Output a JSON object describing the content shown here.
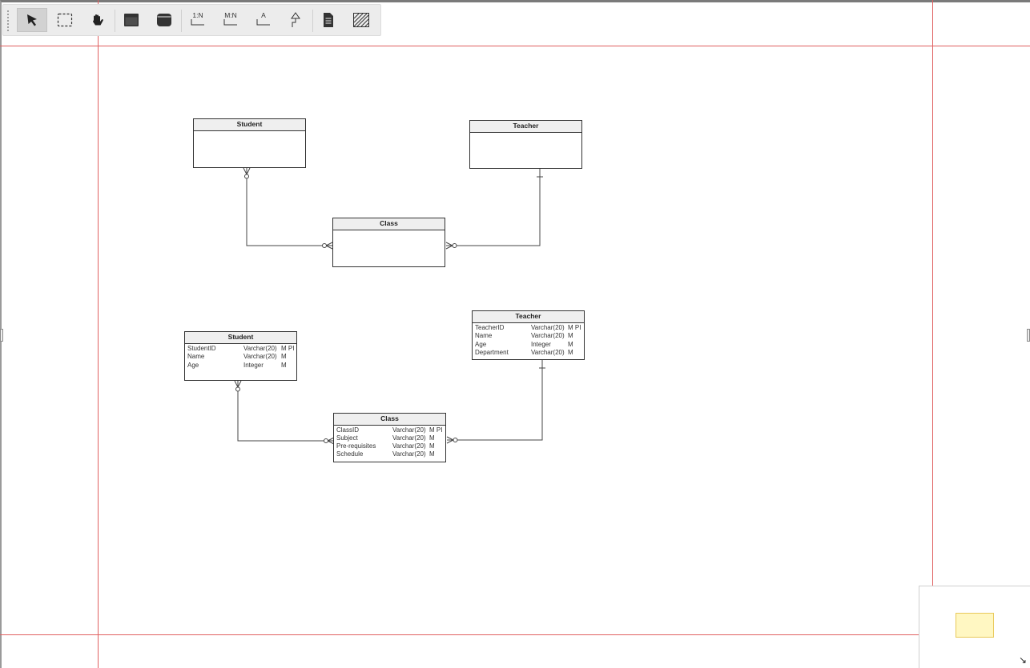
{
  "toolbar": {
    "tools": [
      {
        "name": "select-tool",
        "icon": "arrow-pointer-icon",
        "label": ""
      },
      {
        "name": "marquee-tool",
        "icon": "dashed-rectangle-icon",
        "label": ""
      },
      {
        "name": "pan-tool",
        "icon": "hand-icon",
        "label": ""
      },
      {
        "name": "entity-tool",
        "icon": "table-icon",
        "label": ""
      },
      {
        "name": "view-tool",
        "icon": "rounded-table-icon",
        "label": ""
      },
      {
        "name": "one-to-many-tool",
        "icon": "relation-icon",
        "label": "1:N"
      },
      {
        "name": "many-to-many-tool",
        "icon": "relation-icon",
        "label": "M:N"
      },
      {
        "name": "attribute-relation-tool",
        "icon": "relation-icon",
        "label": "A"
      },
      {
        "name": "inheritance-tool",
        "icon": "inheritance-arrow-icon",
        "label": ""
      },
      {
        "name": "note-tool",
        "icon": "document-icon",
        "label": ""
      },
      {
        "name": "area-tool",
        "icon": "hatched-square-icon",
        "label": ""
      }
    ]
  },
  "diagram_top": {
    "student": {
      "title": "Student"
    },
    "teacher": {
      "title": "Teacher"
    },
    "class": {
      "title": "Class"
    }
  },
  "diagram_bottom": {
    "student": {
      "title": "Student",
      "attributes": [
        {
          "name": "StudentID",
          "type": "Varchar(20)",
          "flags": "M PI"
        },
        {
          "name": "Name",
          "type": "Varchar(20)",
          "flags": "M"
        },
        {
          "name": "Age",
          "type": "Integer",
          "flags": "M"
        }
      ]
    },
    "teacher": {
      "title": "Teacher",
      "attributes": [
        {
          "name": "TeacherID",
          "type": "Varchar(20)",
          "flags": "M PI"
        },
        {
          "name": "Name",
          "type": "Varchar(20)",
          "flags": "M"
        },
        {
          "name": "Age",
          "type": "Integer",
          "flags": "M"
        },
        {
          "name": "Department",
          "type": "Varchar(20)",
          "flags": "M"
        }
      ]
    },
    "class": {
      "title": "Class",
      "attributes": [
        {
          "name": "ClassID",
          "type": "Varchar(20)",
          "flags": "M PI"
        },
        {
          "name": "Subject",
          "type": "Varchar(20)",
          "flags": "M"
        },
        {
          "name": "Pre-requisites",
          "type": "Varchar(20)",
          "flags": "M"
        },
        {
          "name": "Schedule",
          "type": "Varchar(20)",
          "flags": "M"
        }
      ]
    }
  },
  "colors": {
    "guide": "#e06060",
    "line": "#444444",
    "minimap_viewport": "#fff7c2"
  }
}
